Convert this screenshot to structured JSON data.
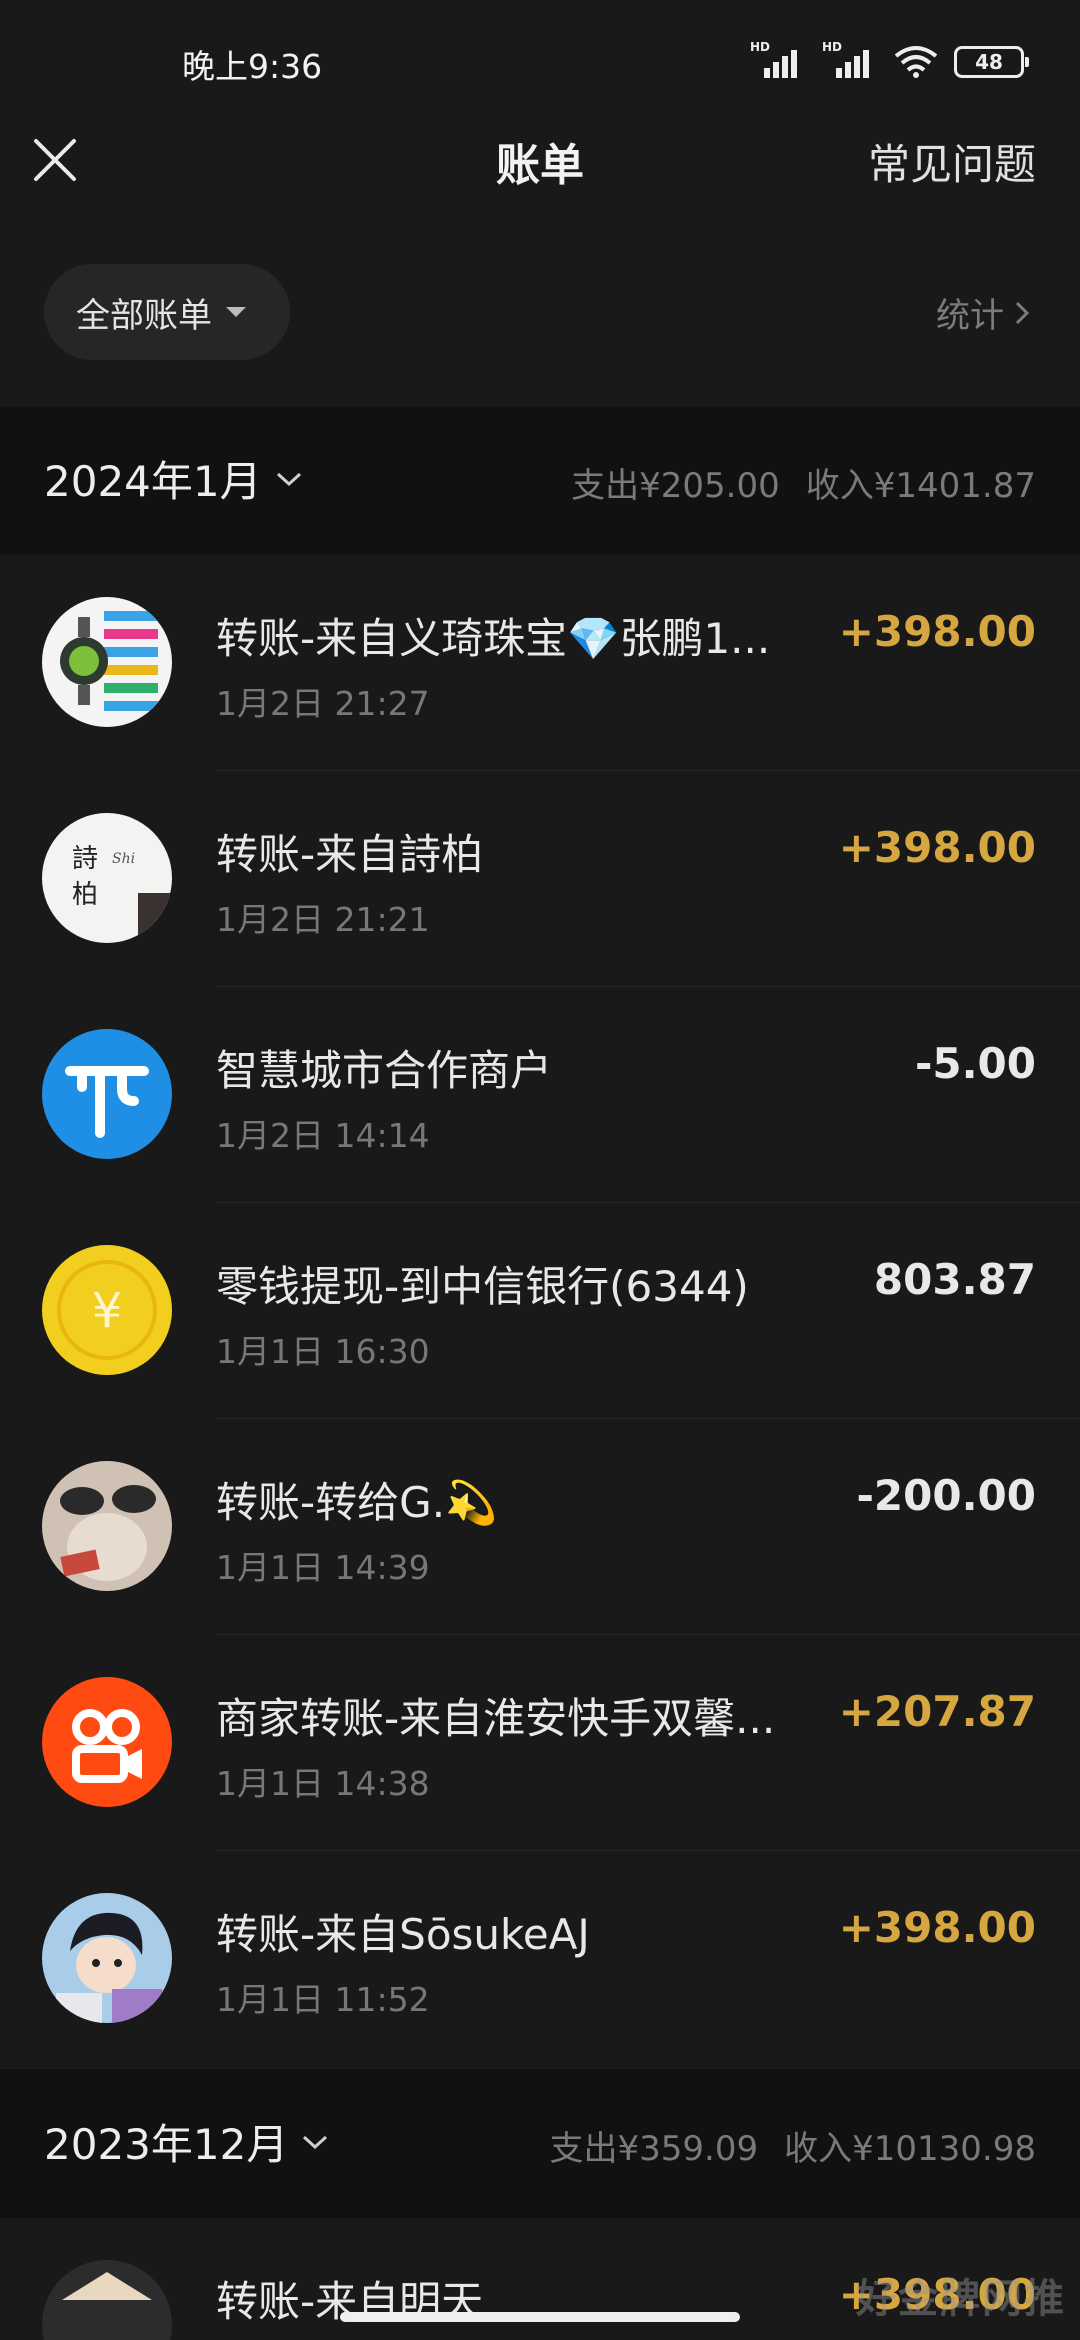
{
  "status_bar": {
    "time": "晚上9:36",
    "sim1": "HD",
    "sim2": "HD",
    "battery": "48"
  },
  "nav": {
    "title": "账单",
    "faq_label": "常见问题"
  },
  "filter": {
    "label": "全部账单",
    "stats_label": "统计"
  },
  "months": [
    {
      "title": "2024年1月",
      "expense": "支出¥205.00",
      "income": "收入¥1401.87"
    },
    {
      "title": "2023年12月",
      "expense": "支出¥359.09",
      "income": "收入¥10130.98"
    }
  ],
  "transactions": [
    {
      "title": "转账-来自义琦珠宝💎张鹏1...",
      "time": "1月2日 21:27",
      "amount": "+398.00",
      "type": "income",
      "avatar": "jewelry-shop-avatar"
    },
    {
      "title": "转账-来自詩柏",
      "time": "1月2日 21:21",
      "amount": "+398.00",
      "type": "income",
      "avatar": "calligraphy-avatar"
    },
    {
      "title": "智慧城市合作商户",
      "time": "1月2日 14:14",
      "amount": "-5.00",
      "type": "expense",
      "avatar": "smart-city-logo"
    },
    {
      "title": "零钱提现-到中信银行(6344)",
      "time": "1月1日 16:30",
      "amount": "803.87",
      "type": "neutral",
      "avatar": "yuan-coin-icon"
    },
    {
      "title": "转账-转给G.💫",
      "time": "1月1日 14:39",
      "amount": "-200.00",
      "type": "expense",
      "avatar": "photo-avatar"
    },
    {
      "title": "商家转账-来自淮安快手双馨...",
      "time": "1月1日 14:38",
      "amount": "+207.87",
      "type": "income",
      "avatar": "kuaishou-logo"
    },
    {
      "title": "转账-来自SōsukeAJ",
      "time": "1月1日 11:52",
      "amount": "+398.00",
      "type": "income",
      "avatar": "anime-avatar"
    }
  ],
  "partial_transaction": {
    "title": "转账-来自明天",
    "amount": "+398.00"
  },
  "watermark": "好金牌网推",
  "colors": {
    "background": "#191919",
    "income": "#d6a640",
    "header_bg": "#111111",
    "coin": "#f2cf1f",
    "kuaishou": "#ff4a12",
    "smart_city": "#1f8fe6"
  }
}
